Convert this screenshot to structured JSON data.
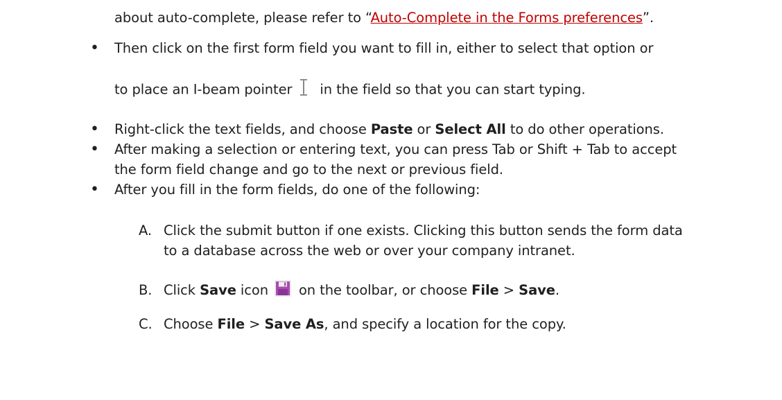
{
  "p0": {
    "before": "about auto-complete, please refer to “",
    "link": "Auto-Complete in the Forms preferences",
    "after": "”."
  },
  "bullet_char": "•",
  "b1": {
    "line1": "Then click on the first form field you want to fill in, either to select that option or",
    "line2_before": "to place an I-beam pointer",
    "line2_after": "in the field so that you can start typing.",
    "icon": "i-beam-cursor-icon"
  },
  "b2": {
    "before": "Right-click the text fields, and choose ",
    "bold1": "Paste",
    "mid": " or ",
    "bold2": "Select All",
    "after": " to do other operations."
  },
  "b3": {
    "line1": "After making a selection or entering text, you can press Tab or Shift + Tab to accept",
    "line2": "the form field change and go to the next or previous field."
  },
  "b4": {
    "text": "After you fill in the form fields, do one of the following:"
  },
  "a": {
    "letter": "A.",
    "line1": "Click the submit button if one exists. Clicking this button sends the form data",
    "line2": "to a database across the web or over your company intranet."
  },
  "b": {
    "letter": "B.",
    "t1": "Click ",
    "bold1": "Save",
    "t2": " icon",
    "t3": "on the toolbar, or choose ",
    "bold2": "File",
    "t4": " > ",
    "bold3": "Save",
    "t5": ".",
    "icon": "save-icon",
    "icon_color": "#a84bb3"
  },
  "c": {
    "letter": "C.",
    "t1": "Choose ",
    "bold1": "File",
    "t2": " > ",
    "bold2": "Save As",
    "t3": ", and specify a location for the copy."
  }
}
